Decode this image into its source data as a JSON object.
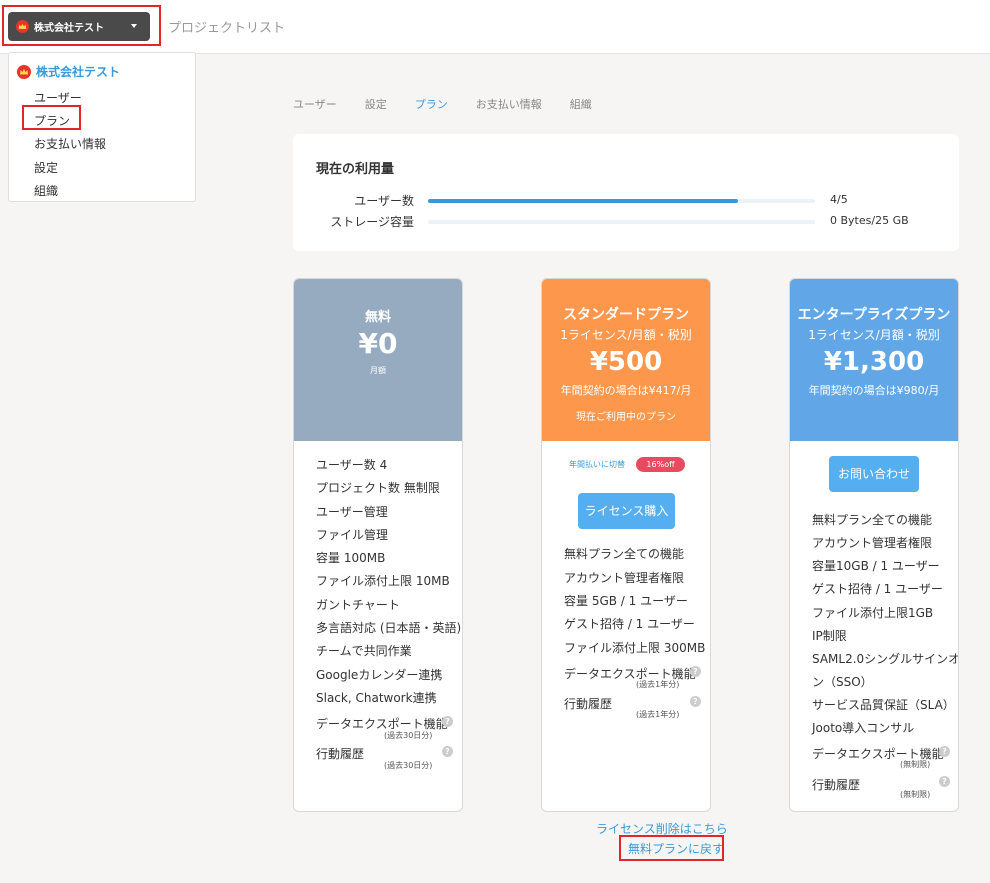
{
  "header": {
    "org_name": "株式会社テスト",
    "project_list_label": "プロジェクトリスト"
  },
  "dropdown": {
    "org_name": "株式会社テスト",
    "items": [
      {
        "label": "ユーザー"
      },
      {
        "label": "プラン"
      },
      {
        "label": "お支払い情報"
      },
      {
        "label": "設定"
      },
      {
        "label": "組織"
      }
    ]
  },
  "tabs": [
    {
      "label": "ユーザー",
      "active": false
    },
    {
      "label": "設定",
      "active": false
    },
    {
      "label": "プラン",
      "active": true
    },
    {
      "label": "お支払い情報",
      "active": false
    },
    {
      "label": "組織",
      "active": false
    }
  ],
  "usage": {
    "title": "現在の利用量",
    "rows": [
      {
        "label": "ユーザー数",
        "value": "4/5",
        "fraction": 0.8
      },
      {
        "label": "ストレージ容量",
        "value": "0 Bytes/25 GB",
        "fraction": 0
      }
    ]
  },
  "plans": {
    "free": {
      "name": "無料",
      "price": "¥0",
      "period": "月額",
      "color": "#97abc0",
      "features": [
        "ユーザー数 4",
        "プロジェクト数 無制限",
        "ユーザー管理",
        "ファイル管理",
        "容量 100MB",
        "ファイル添付上限 10MB",
        "ガントチャート",
        "多言語対応 (日本語・英語)",
        "チームで共同作業",
        "Googleカレンダー連携",
        "Slack, Chatwork連携"
      ],
      "export_label": "データエクスポート機能",
      "export_sub": "(過去30日分)",
      "history_label": "行動履歴",
      "history_sub": "(過去30日分)"
    },
    "standard": {
      "name": "スタンダードプラン",
      "subtitle": "1ライセンス/月額・税別",
      "price": "¥500",
      "annual_note": "年間契約の場合は¥417/月",
      "current_label": "現在ご利用中のプラン",
      "color": "#fd974c",
      "switch_label": "年間払いに切替",
      "discount_badge": "16%off",
      "buy_button": "ライセンス購入",
      "features": [
        "無料プラン全ての機能",
        "アカウント管理者権限",
        "容量 5GB / 1 ユーザー",
        "ゲスト招待 / 1 ユーザー",
        "ファイル添付上限 300MB"
      ],
      "export_label": "データエクスポート機能",
      "export_sub": "(過去1年分)",
      "history_label": "行動履歴",
      "history_sub": "(過去1年分)"
    },
    "enterprise": {
      "name": "エンタープライズプラン",
      "subtitle": "1ライセンス/月額・税別",
      "price": "¥1,300",
      "annual_note": "年間契約の場合は¥980/月",
      "color": "#61a7e8",
      "contact_button": "お問い合わせ",
      "features": [
        "無料プラン全ての機能",
        "アカウント管理者権限",
        "容量10GB / 1 ユーザー",
        "ゲスト招待 / 1 ユーザー",
        "ファイル添付上限1GB",
        "IP制限",
        "SAML2.0シングルサインオ",
        "ン（SSO）",
        "サービス品質保証（SLA）",
        "Jooto導入コンサル"
      ],
      "export_label": "データエクスポート機能",
      "export_sub": "(無制限)",
      "history_label": "行動履歴",
      "history_sub": "(無制限)"
    }
  },
  "links": {
    "delete_license": "ライセンス削除はこちら",
    "back_to_free": "無料プランに戻す"
  },
  "icons": {
    "crown": "crown-icon",
    "caret": "chevron-down-icon",
    "help": "question-icon"
  },
  "colors": {
    "accent": "#3a9ad9",
    "highlight": "#e0262b",
    "badge": "#e84a5f"
  }
}
